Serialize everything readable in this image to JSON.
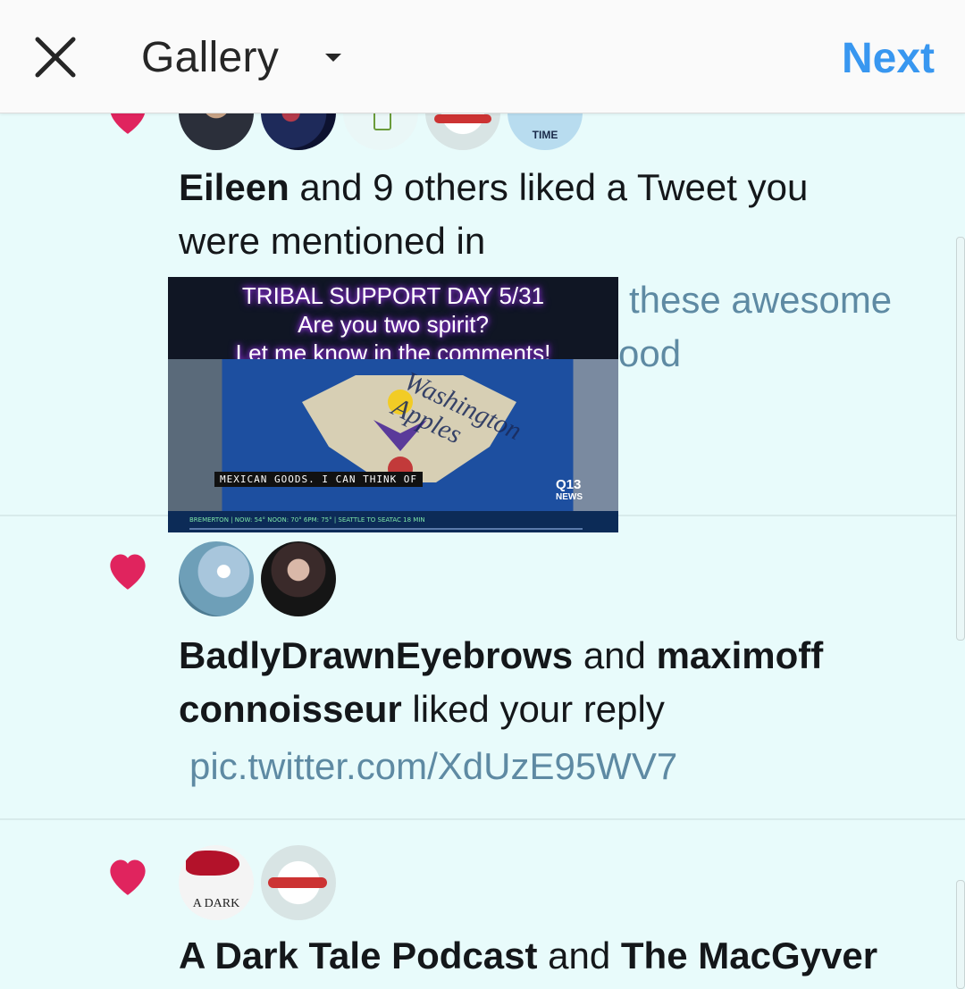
{
  "topbar": {
    "close_icon": "close-icon",
    "title": "Gallery",
    "dropdown_icon": "caret-down-icon",
    "next_label": "Next"
  },
  "notifications": [
    {
      "actor": "Eileen",
      "rest_line1": " and 9 others liked a Tweet you",
      "line2": "were mentioned in",
      "preview_line1": "these awesome",
      "preview_line2": "ood"
    },
    {
      "actor1": "BadlyDrawnEyebrows",
      "and": " and ",
      "actor2a": "maximoff",
      "actor2b": "connoisseur",
      "rest": " liked your reply",
      "link": "pic.twitter.com/XdUzE95WV7"
    },
    {
      "actor1": "A Dark Tale Podcast",
      "and": " and ",
      "actor2": "The MacGyver"
    }
  ],
  "video_overlay": {
    "banner_line1": "TRIBAL SUPPORT DAY 5/31",
    "banner_line2": "Are you two spirit?",
    "banner_line3": "Let me know in the comments!",
    "caption": "MEXICAN GOODS. I CAN THINK OF",
    "wall_text": "Washington Apples",
    "station_line1": "Q13",
    "station_line2": "NEWS",
    "ticker_text": "BREMERTON | NOW: 54° NOON: 70° 6PM: 75° | SEATTLE TO SEATAC 18 MIN"
  },
  "avatar_labels": {
    "time_sensitive": "TIME",
    "dark_tale": "A DARK"
  },
  "colors": {
    "accent": "#3897f0",
    "heart": "#e0245e",
    "link": "#5e8aa3",
    "background": "#e8fbfb"
  }
}
